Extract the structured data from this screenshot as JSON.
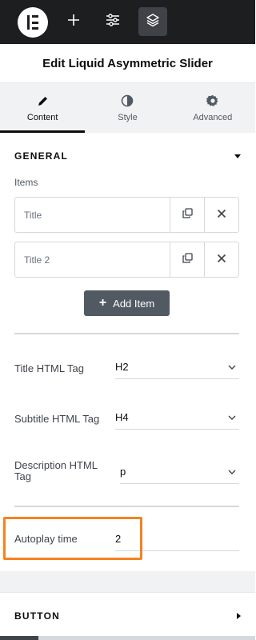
{
  "editor": {
    "title": "Edit Liquid Asymmetric Slider"
  },
  "topbar": {
    "icons": [
      "elementor-logo-icon",
      "plus-icon",
      "sliders-icon",
      "layers-icon"
    ],
    "active_icon": "layers-icon"
  },
  "tabs": [
    {
      "label": "Content",
      "icon": "pencil-icon",
      "active": true
    },
    {
      "label": "Style",
      "icon": "half-circle-icon",
      "active": false
    },
    {
      "label": "Advanced",
      "icon": "gear-icon",
      "active": false
    }
  ],
  "general": {
    "heading": "GENERAL",
    "items_label": "Items",
    "items": [
      {
        "title": "Title"
      },
      {
        "title": "Title 2"
      }
    ],
    "add_item_label": "Add Item",
    "controls": {
      "title_tag": {
        "label": "Title HTML Tag",
        "value": "H2"
      },
      "subtitle_tag": {
        "label": "Subtitle HTML Tag",
        "value": "H4"
      },
      "description_tag": {
        "label": "Description HTML Tag",
        "value": "p"
      },
      "autoplay": {
        "label": "Autoplay time",
        "value": "2"
      }
    }
  },
  "button_section": {
    "heading": "BUTTON"
  },
  "colors": {
    "highlight": "#f58220",
    "topbar": "#1d1e20",
    "add_button": "#515962"
  }
}
